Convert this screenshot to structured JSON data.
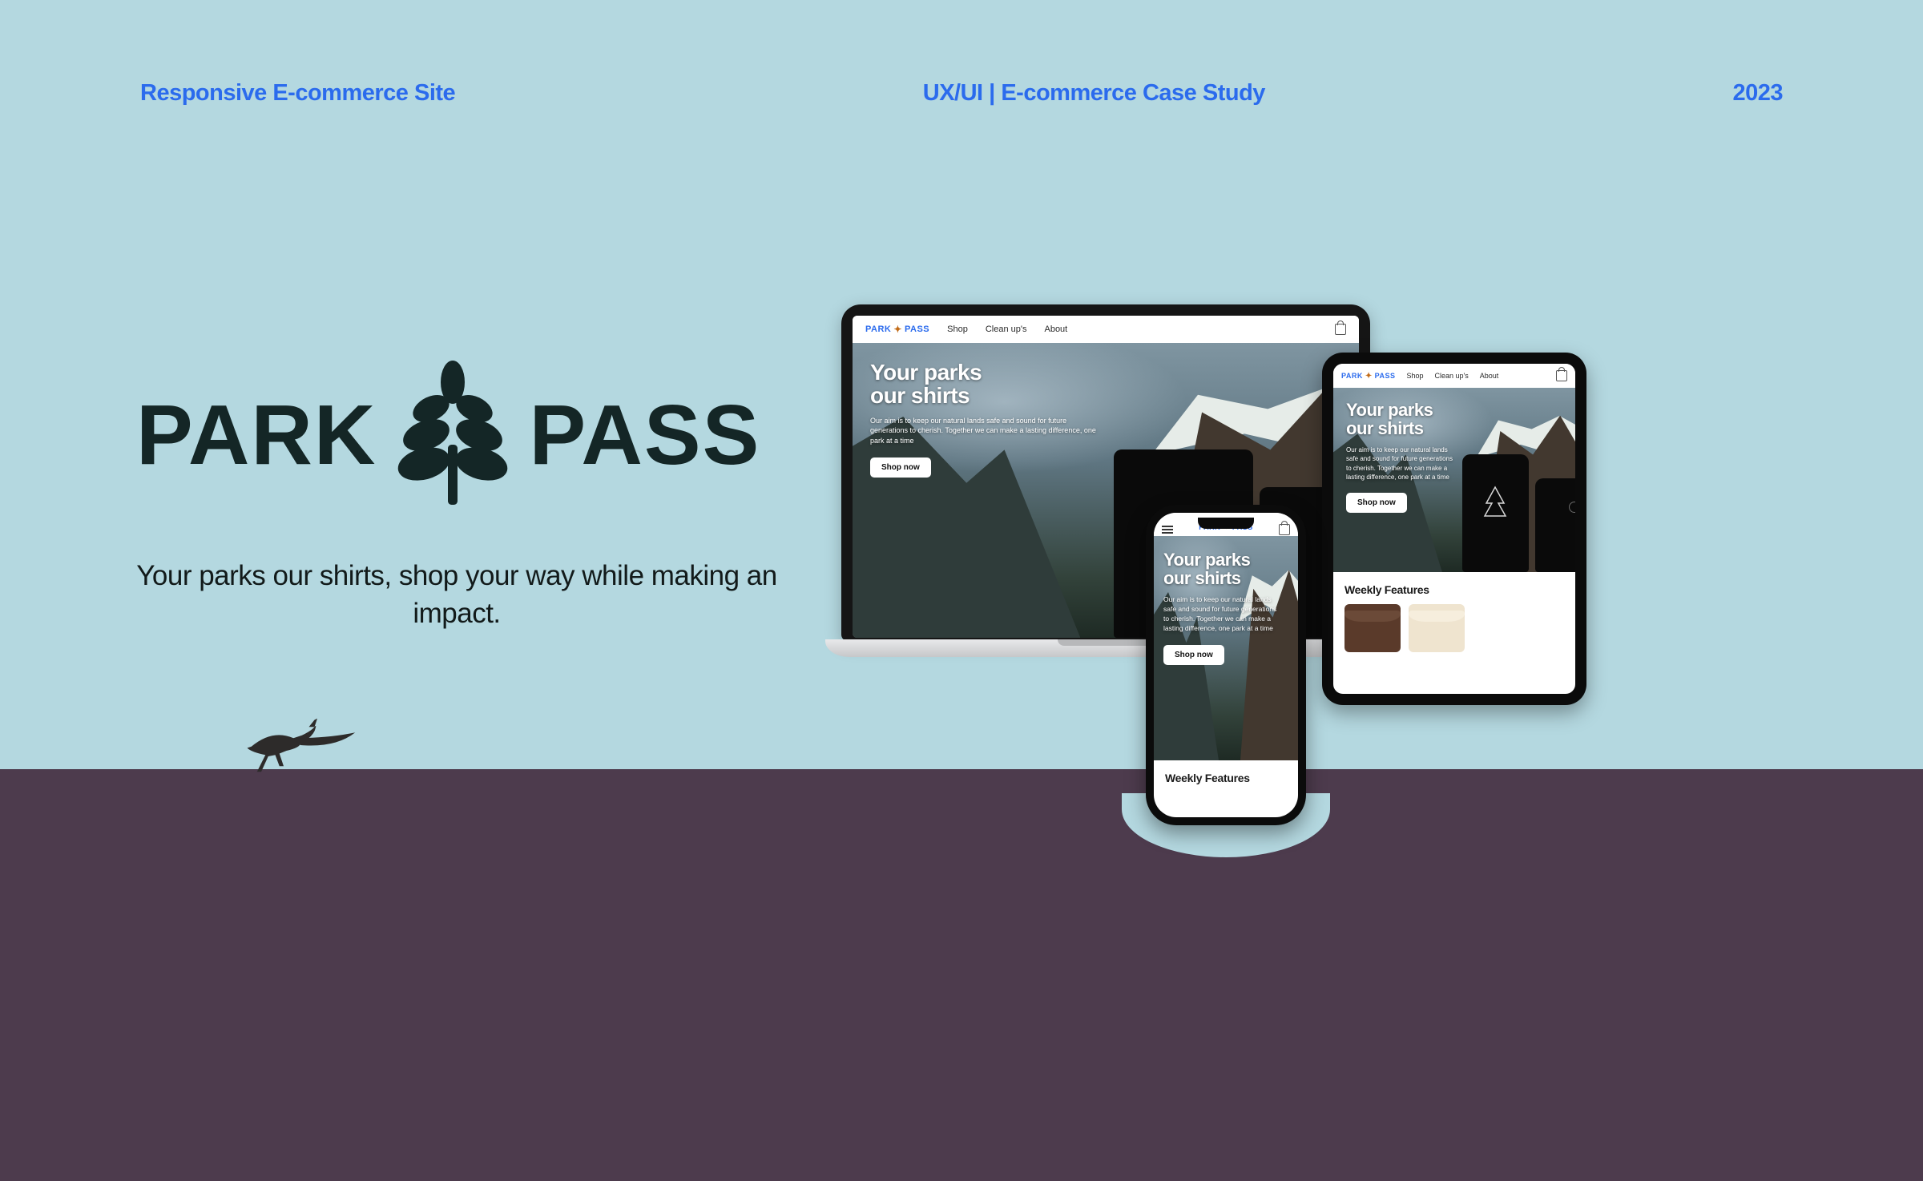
{
  "header": {
    "left": "Responsive E-commerce Site",
    "center": "UX/UI | E-commerce Case Study",
    "right": "2023"
  },
  "brand": {
    "word1": "PARK",
    "word2": "PASS",
    "tagline": "Your parks our shirts, shop your way while making an impact."
  },
  "site": {
    "logo_park": "PARK",
    "logo_pass": "PASS",
    "nav": {
      "shop": "Shop",
      "cleanups": "Clean up's",
      "about": "About"
    },
    "hero": {
      "headline_l1": "Your parks",
      "headline_l2": "our shirts",
      "sub": "Our aim is to keep our natural lands safe and sound for future generations to cherish. Together we can make a lasting difference, one park at a time",
      "cta": "Shop now"
    },
    "features_heading": "Weekly Features"
  },
  "colors": {
    "bg_top": "#b4d8e0",
    "bg_bottom": "#4d3b4d",
    "accent_blue": "#2b6bed",
    "brand_dark": "#142626"
  }
}
